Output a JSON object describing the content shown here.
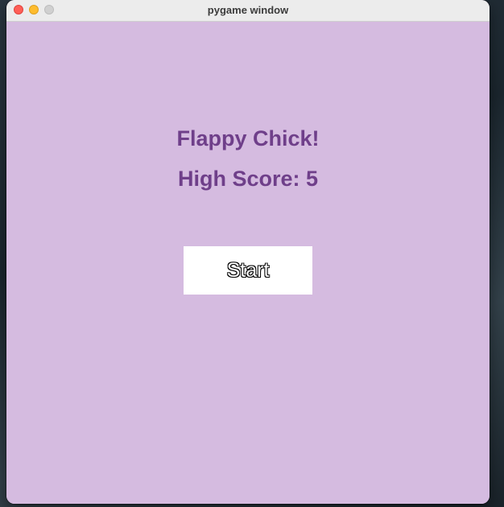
{
  "window": {
    "title": "pygame window"
  },
  "game": {
    "title": "Flappy Chick!",
    "high_score_text": "High Score: 5",
    "start_label": "Start"
  },
  "colors": {
    "background": "#d5bbe0",
    "text": "#6f3f8a",
    "button": "#ffffff"
  }
}
